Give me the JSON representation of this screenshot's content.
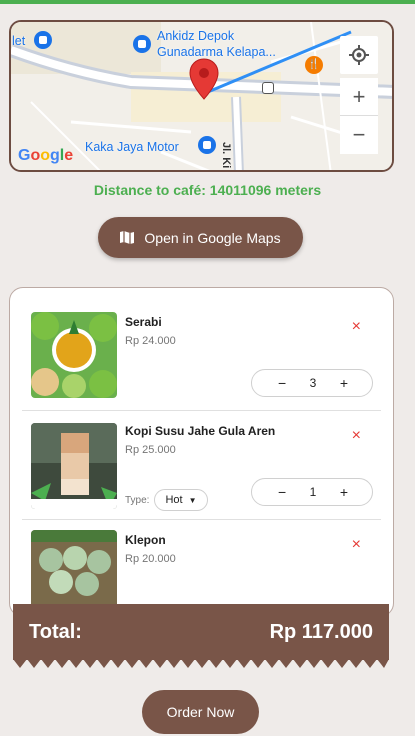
{
  "map": {
    "labels": {
      "outlet_partial": "let",
      "poi_1": "Ankidz Depok",
      "poi_1_sub": "Gunadarma Kelapa...",
      "poi_2": "Kaka Jaya Motor",
      "street": "Jl. Ki"
    },
    "google_logo": "Google",
    "controls": {
      "locate": "my-location-icon",
      "zoom_in": "+",
      "zoom_out": "−"
    }
  },
  "distance_text": "Distance to café: 14011096 meters",
  "open_maps_label": "Open in Google Maps",
  "cart": {
    "items": [
      {
        "name": "Serabi",
        "price": "Rp 24.000",
        "quantity": "3",
        "remove": "×"
      },
      {
        "name": "Kopi Susu Jahe Gula Aren",
        "price": "Rp 25.000",
        "quantity": "1",
        "remove": "×",
        "type_label": "Type:",
        "type_value": "Hot"
      },
      {
        "name": "Klepon",
        "price": "Rp 20.000",
        "remove": "×"
      }
    ],
    "stepper_minus": "−",
    "stepper_plus": "+"
  },
  "total": {
    "label": "Total:",
    "value": "Rp 117.000"
  },
  "order_now_label": "Order Now",
  "colors": {
    "accent": "#795548",
    "success": "#4caf50",
    "danger": "#e53935"
  }
}
